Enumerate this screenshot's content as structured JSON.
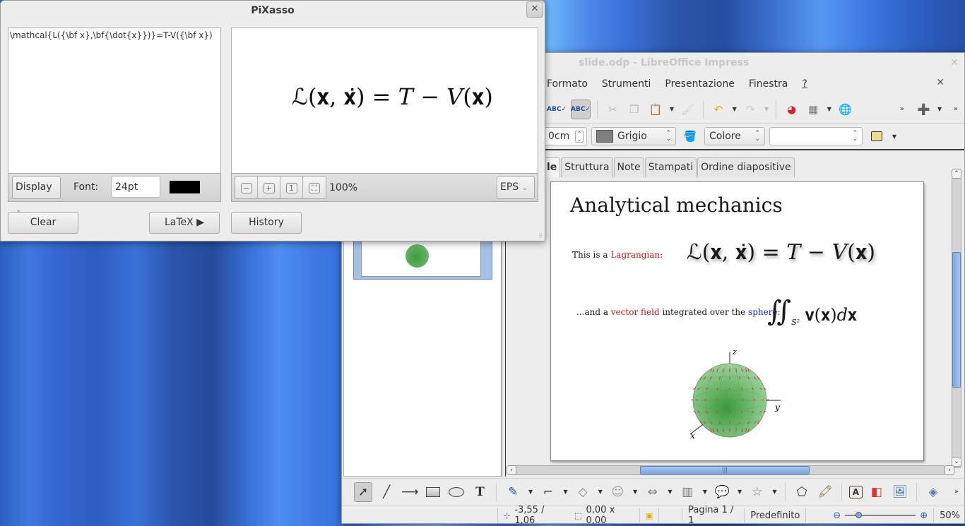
{
  "pixasso": {
    "title": "PiXasso",
    "source": "\\mathcal{L({\\bf x},\\bf{\\dot{x}})}=T-V({\\bf x})",
    "preview_equation": "ℒ(𝐱, 𝐱̇) = 𝑇 − 𝑉(𝐱)",
    "mode": "Display",
    "font_label": "Font:",
    "font_size": "24pt",
    "color": "#000000",
    "zoom": "100%",
    "format": "EPS",
    "buttons": {
      "clear": "Clear",
      "latex": "LaTeX ▶",
      "history": "History"
    }
  },
  "impress": {
    "title": "slide.odp - LibreOffice Impress",
    "menu": [
      "Formato",
      "Strumenti",
      "Presentazione",
      "Finestra",
      "?"
    ],
    "line_width": "0cm",
    "line_color": {
      "label": "Grigio",
      "swatch": "#808080"
    },
    "area_style": "Colore",
    "area_value": "",
    "tabs": [
      "le",
      "Struttura",
      "Note",
      "Stampati",
      "Ordine diapositive"
    ],
    "slide": {
      "title": "Analytical mechanics",
      "line1": {
        "prefix": "This is a ",
        "highlight": "Lagrangian",
        "suffix": ":"
      },
      "eq1": "ℒ(𝐱, 𝐱̇) = 𝑇 − 𝑉(𝐱)",
      "line2": {
        "prefix": "...and a ",
        "highlight1": "vector field",
        "middle": " integrated over the ",
        "highlight2": "sphere",
        "suffix": ":"
      },
      "eq2": "∬",
      "eq2_sub": "S²",
      "eq2_body": "𝐯(𝐱)𝑑𝐱",
      "axes": {
        "z": "z",
        "y": "y",
        "x": "x"
      }
    },
    "status": {
      "position": "-3,55 / 1,06",
      "size": "0,00 x 0,00",
      "page": "Pagina 1 / 1",
      "layout": "Predefinito",
      "zoom": "50%",
      "zoom_level_percent": 50
    }
  }
}
